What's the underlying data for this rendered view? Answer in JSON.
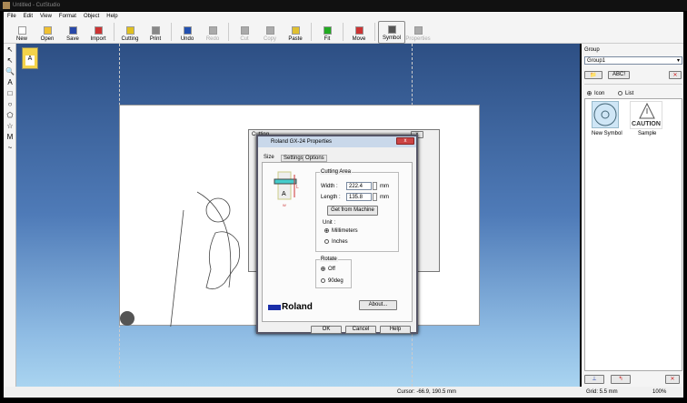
{
  "window": {
    "title": "Untitled - CutStudio"
  },
  "menu": [
    "File",
    "Edit",
    "View",
    "Format",
    "Object",
    "Help"
  ],
  "toolbar": [
    {
      "label": "New",
      "enabled": true
    },
    {
      "label": "Open",
      "enabled": true
    },
    {
      "label": "Save",
      "enabled": true
    },
    {
      "label": "Import",
      "enabled": true
    },
    {
      "label": "Cutting",
      "enabled": true
    },
    {
      "label": "Print",
      "enabled": true
    },
    {
      "label": "Undo",
      "enabled": true
    },
    {
      "label": "Redo",
      "enabled": false
    },
    {
      "label": "Cut",
      "enabled": false
    },
    {
      "label": "Copy",
      "enabled": false
    },
    {
      "label": "Paste",
      "enabled": true
    },
    {
      "label": "Fit",
      "enabled": true
    },
    {
      "label": "Move",
      "enabled": true
    },
    {
      "label": "Symbol",
      "enabled": true
    },
    {
      "label": "Properties",
      "enabled": false
    }
  ],
  "tools": [
    "↖",
    "↖",
    "🔍",
    "A",
    "□",
    "○",
    "⬠",
    "☆",
    "M",
    "~"
  ],
  "right_panel": {
    "group_label": "Group",
    "group_value": "Group1",
    "abc_button": "ABC!",
    "view_icon": "Icon",
    "view_list": "List",
    "symbols": [
      "New Symbol",
      "Sample"
    ],
    "caution_text": "CAUTION"
  },
  "cutting_dialog": {
    "title": "Cutting",
    "close": "x"
  },
  "props_dialog": {
    "title": "Roland GX-24 Properties",
    "close": "x",
    "tabs": [
      "Size",
      "Settings",
      "Options"
    ],
    "cutting_area_label": "Cutting Area",
    "width_label": "Width :",
    "width_value": "222.4",
    "length_label": "Length :",
    "length_value": "135.8",
    "unit_mm": "mm",
    "get_from_machine": "Get from Machine",
    "unit_label": "Unit :",
    "unit_options": [
      "Millimeters",
      "Inches"
    ],
    "unit_selected": "Millimeters",
    "rotate_label": "Rotate",
    "rotate_options": [
      "Off",
      "90deg"
    ],
    "rotate_selected": "Off",
    "brand": "Roland",
    "about": "About...",
    "ok": "OK",
    "cancel": "Cancel",
    "help": "Help",
    "diagram_a": "A",
    "diagram_l": "L",
    "diagram_w": "W"
  },
  "status": {
    "cursor": "Cursor: -66.9, 190.5 mm",
    "grid": "Grid: 5.5 mm",
    "zoom": "100%"
  }
}
